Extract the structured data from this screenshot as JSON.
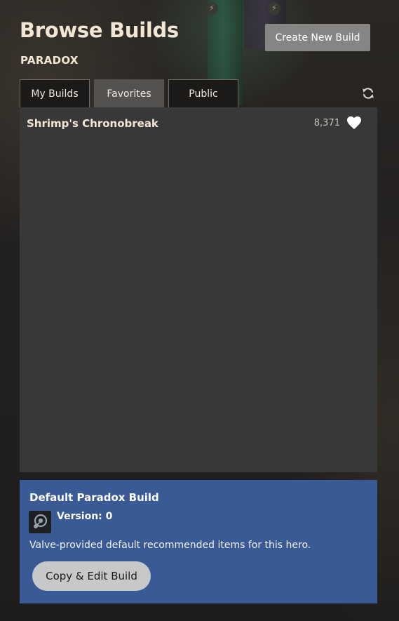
{
  "header": {
    "title": "Browse Builds",
    "hero": "PARADOX",
    "create_button": "Create New Build"
  },
  "tabs": [
    {
      "label": "My Builds",
      "active": false
    },
    {
      "label": "Favorites",
      "active": true
    },
    {
      "label": "Public",
      "active": false
    }
  ],
  "toolbar": {
    "refresh_icon": "refresh-icon"
  },
  "builds": [
    {
      "name": "Shrimp's Chronobreak",
      "favorites": "8,371",
      "favorited": true,
      "icon": "heart-icon"
    }
  ],
  "selected_build": {
    "title": "Default Paradox Build",
    "version_label": "Version:",
    "version": "0",
    "version_text": "Version: 0",
    "author_icon": "steam-icon",
    "description": "Valve-provided default recommended items for this hero.",
    "copy_button": "Copy & Edit Build"
  },
  "colors": {
    "accent_panel": "#3a5a95",
    "list_background": "#383838",
    "title_text": "#f3e7d4",
    "active_tab": "#535251"
  }
}
